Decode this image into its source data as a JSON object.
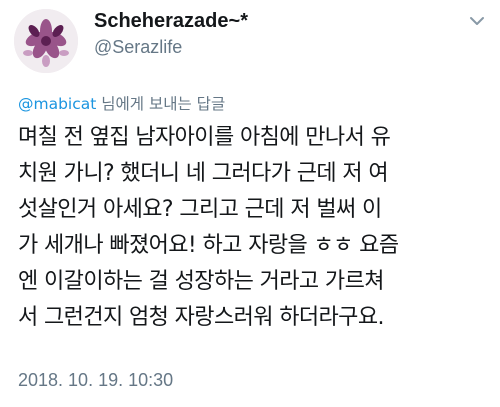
{
  "tweet": {
    "author": {
      "display_name": "Scheherazade~*",
      "handle": "@Serazlife",
      "avatar_icon": "flower-avatar-icon"
    },
    "more_icon": "chevron-down-icon",
    "reply_context": {
      "mention": "@mabicat",
      "suffix": " 님에게 보내는 답글"
    },
    "text_lines": [
      "며칠 전 옆집 남자아이를 아침에 만나서 유",
      "치원 가니? 했더니 네 그러다가 근데 저 여",
      "섯살인거 아세요? 그리고 근데 저 벌써 이",
      "가 세개나 빠졌어요! 하고 자랑을 ㅎㅎ 요즘",
      "엔 이갈이하는 걸 성장하는 거라고 가르쳐",
      "서 그런건지 엄청 자랑스러워 하더라구요."
    ],
    "timestamp": "2018. 10. 19. 10:30",
    "colors": {
      "link": "#1b95e0",
      "muted": "#657786",
      "text": "#14171a"
    }
  }
}
